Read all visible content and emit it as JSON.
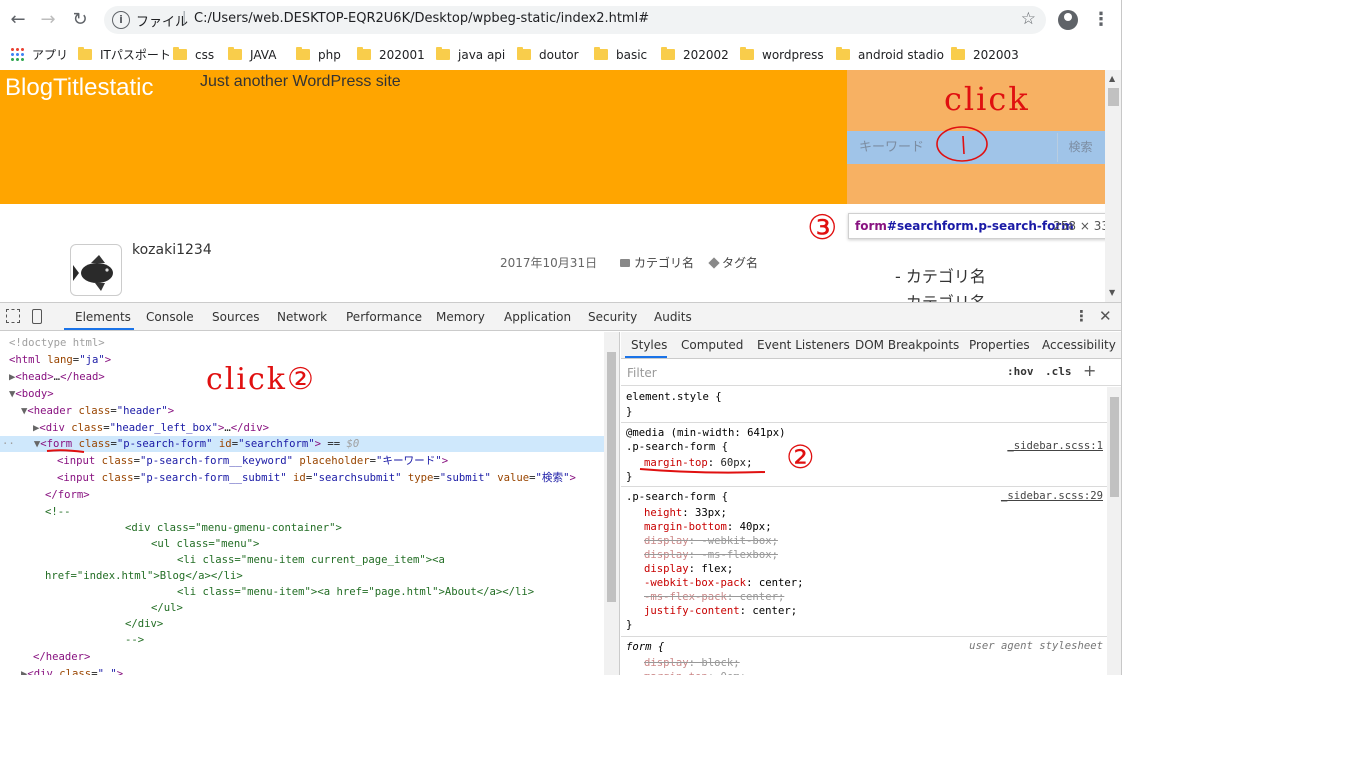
{
  "browser": {
    "omnibox": {
      "scheme_label": "ファイル",
      "separator": "|",
      "url": "C:/Users/web.DESKTOP-EQR2U6K/Desktop/wpbeg-static/index2.html#"
    },
    "icons": [
      "back-arrow-icon",
      "forward-arrow-icon",
      "reload-icon",
      "info-icon",
      "star-icon",
      "profile-icon",
      "more-vert-icon"
    ]
  },
  "bookmarks": [
    {
      "label": "アプリ",
      "icon": "apps-grid-icon"
    },
    {
      "label": "ITパスポート",
      "icon": "folder-icon"
    },
    {
      "label": "css",
      "icon": "folder-icon"
    },
    {
      "label": "JAVA",
      "icon": "folder-icon"
    },
    {
      "label": "php",
      "icon": "folder-icon"
    },
    {
      "label": "202001",
      "icon": "folder-icon"
    },
    {
      "label": "java api",
      "icon": "folder-icon"
    },
    {
      "label": "doutor",
      "icon": "folder-icon"
    },
    {
      "label": "basic",
      "icon": "folder-icon"
    },
    {
      "label": "202002",
      "icon": "folder-icon"
    },
    {
      "label": "wordpress",
      "icon": "folder-icon"
    },
    {
      "label": "android stadio",
      "icon": "folder-icon"
    },
    {
      "label": "202003",
      "icon": "folder-icon"
    }
  ],
  "page": {
    "site_title": "BlogTitlestatic",
    "tagline": "Just another WordPress site",
    "search_placeholder": "キーワード",
    "search_submit": "検索",
    "tooltip": {
      "selector_tag": "form",
      "selector_rest": "#searchform.p-search-form",
      "dims": "258 × 33"
    },
    "author": "kozaki1234",
    "date": "2017年10月31日",
    "category": "カテゴリ名",
    "tag": "タグ名",
    "sidebar_categories": [
      "- カテゴリ名",
      "- カテゴリ名"
    ]
  },
  "devtools": {
    "tabs": [
      "Elements",
      "Console",
      "Sources",
      "Network",
      "Performance",
      "Memory",
      "Application",
      "Security",
      "Audits"
    ],
    "active_tab": "Elements",
    "styles_tabs": [
      "Styles",
      "Computed",
      "Event Listeners",
      "DOM Breakpoints",
      "Properties",
      "Accessibility"
    ],
    "filter_placeholder": "Filter",
    "hov": ":hov",
    "cls": ".cls",
    "plus": "+"
  },
  "annotations": {
    "click1": "click",
    "click2": "click②",
    "num2": "②",
    "num3": "③"
  },
  "colors": {
    "header_bg": "#ffa500",
    "search_highlight": "#f6b26b",
    "search_box": "#a0c4e8",
    "selected_node": "#cfe8fc",
    "annotation_red": "#e01010",
    "tab_active": "#1a73e8"
  }
}
